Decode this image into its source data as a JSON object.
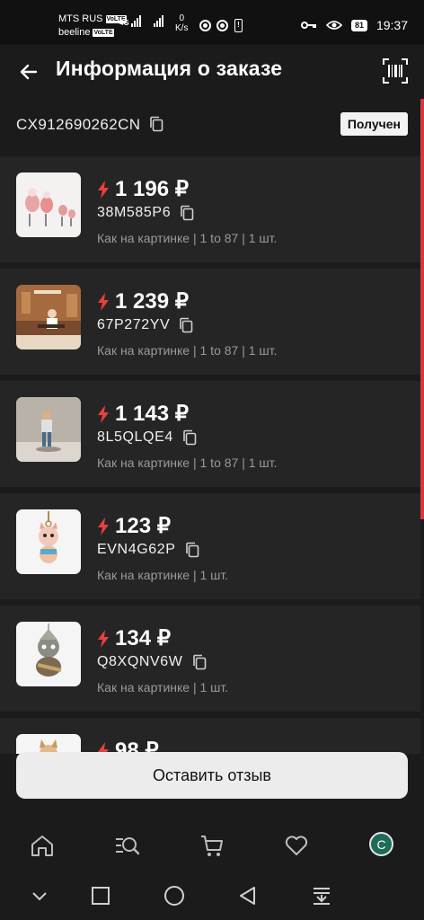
{
  "status_bar": {
    "carrier1": "MTS RUS",
    "carrier2": "beeline",
    "volte": "VoLTE",
    "network": "4G",
    "speed_value": "0",
    "speed_unit": "K/s",
    "battery": "81",
    "time": "19:37"
  },
  "header": {
    "title": "Информация о заказе"
  },
  "tracking": {
    "number": "CX912690262CN",
    "status": "Получен"
  },
  "items": [
    {
      "price": "1 196 ₽",
      "sku": "38M585P6",
      "variant": "Как на картинке | 1 to 87 | 1 шт."
    },
    {
      "price": "1 239 ₽",
      "sku": "67P272YV",
      "variant": "Как на картинке | 1 to 87 | 1 шт."
    },
    {
      "price": "1 143 ₽",
      "sku": "8L5QLQE4",
      "variant": "Как на картинке | 1 to 87 | 1 шт."
    },
    {
      "price": "123 ₽",
      "sku": "EVN4G62P",
      "variant": "Как на картинке | 1 шт."
    },
    {
      "price": "134 ₽",
      "sku": "Q8XQNV6W",
      "variant": "Как на картинке | 1 шт."
    },
    {
      "price": "98 ₽",
      "sku": "",
      "variant": ""
    }
  ],
  "review_button": "Оставить отзыв",
  "bottom_nav": {
    "items": [
      "home-icon",
      "catalog-search-icon",
      "cart-icon",
      "favorites-icon"
    ],
    "avatar_letter": "С"
  },
  "colors": {
    "accent": "#e8403f",
    "background": "#1b1b1b",
    "card": "#252525"
  }
}
